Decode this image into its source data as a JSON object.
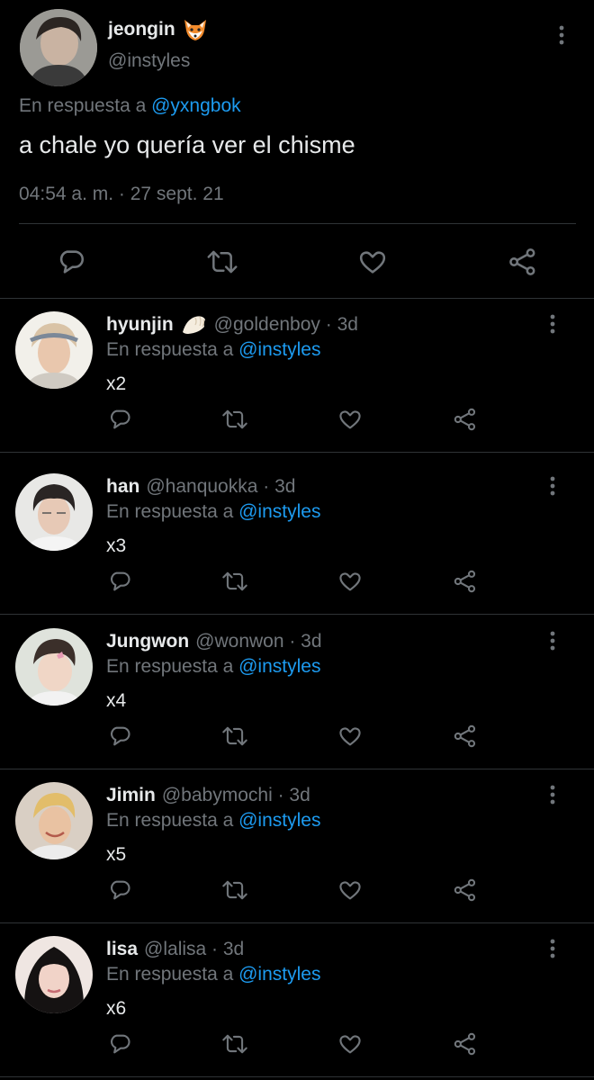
{
  "main_tweet": {
    "name": "jeongin",
    "emoji": "fox-icon",
    "handle": "@instyles",
    "reply_prefix": "En respuesta a",
    "reply_to": "@yxngbok",
    "text": "a chale yo quería ver el chisme",
    "timestamp": "04:54 a. m. · 27 sept. 21",
    "actions": [
      "reply-icon",
      "retweet-icon",
      "like-icon",
      "share-icon"
    ]
  },
  "replies": [
    {
      "name": "hyunjin",
      "emoji": "dumpling-icon",
      "handle": "@goldenboy · 3d",
      "reply_prefix": "En respuesta a",
      "reply_to": "@instyles",
      "text": "x2"
    },
    {
      "name": "han",
      "handle": "@hanquokka · 3d",
      "reply_prefix": "En respuesta a",
      "reply_to": "@instyles",
      "text": "x3"
    },
    {
      "name": "Jungwon",
      "handle": "@wonwon · 3d",
      "reply_prefix": "En respuesta a",
      "reply_to": "@instyles",
      "text": "x4"
    },
    {
      "name": "Jimin",
      "handle": "@babymochi · 3d",
      "reply_prefix": "En respuesta a",
      "reply_to": "@instyles",
      "text": "x5"
    },
    {
      "name": "lisa",
      "handle": "@lalisa · 3d",
      "reply_prefix": "En respuesta a",
      "reply_to": "@instyles",
      "text": "x6"
    }
  ],
  "colors": {
    "background": "#000000",
    "text": "#e7e9ea",
    "muted": "#71767b",
    "link": "#1d9bf0",
    "divider": "#2f3336"
  }
}
